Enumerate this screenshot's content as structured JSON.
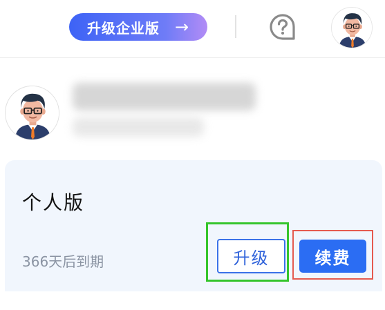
{
  "header": {
    "upgrade_enterprise_label": "升级企业版",
    "upgrade_enterprise_arrow": "→",
    "help_icon": "question-bubble-icon",
    "avatar_icon": "user-avatar-cartoon"
  },
  "profile": {
    "avatar_icon": "user-avatar-cartoon"
  },
  "plan": {
    "title": "个人版",
    "expiry_text": "366天后到期",
    "upgrade_label": "升级",
    "renew_label": "续费"
  },
  "colors": {
    "accent_blue": "#2b6df3",
    "gradient_start": "#3d63f6",
    "gradient_end": "#b28cf6",
    "card_bg": "#f1f6fd",
    "highlight_green": "#35c52c",
    "highlight_red": "#e55a4f"
  }
}
